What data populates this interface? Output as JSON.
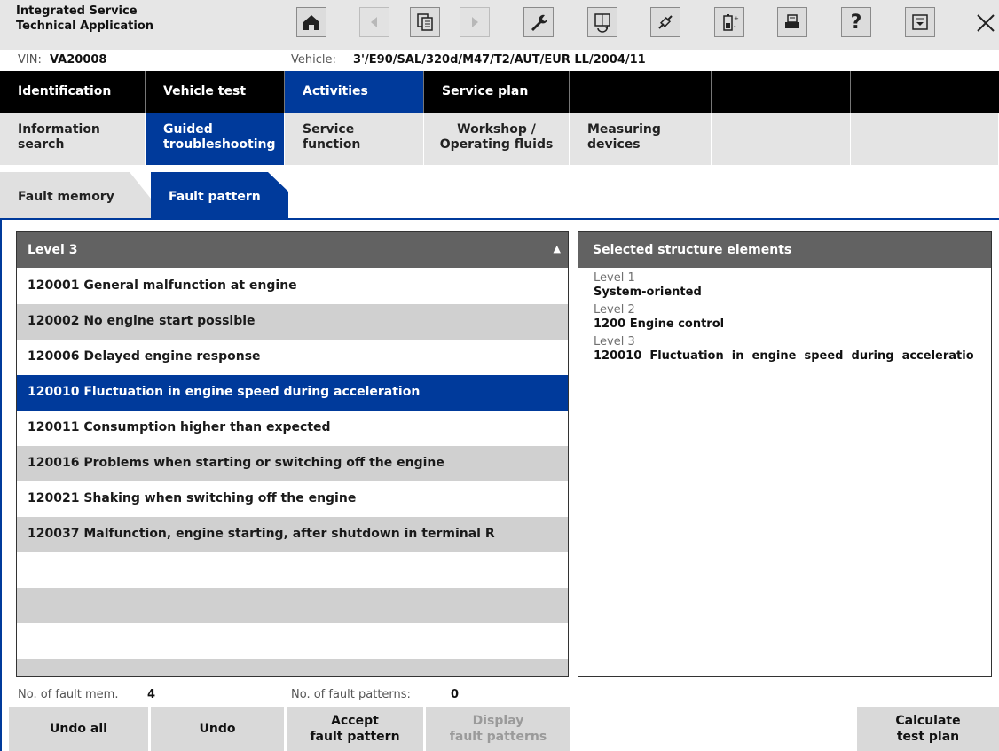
{
  "app": {
    "title_line1": "Integrated Service",
    "title_line2": "Technical Application"
  },
  "toolbar": {
    "icons": [
      "home-icon",
      "back-arrow-icon",
      "documents-icon",
      "forward-arrow-icon",
      "wrench-icon",
      "code-sheet-icon",
      "cable-icon",
      "battery-icon",
      "printer-icon",
      "help-icon",
      "dropdown-menu-icon",
      "close-icon"
    ],
    "help_label": "?"
  },
  "vehicle": {
    "vin_label": "VIN:",
    "vin": "VA20008",
    "vehicle_label": "Vehicle:",
    "vehicle": "3'/E90/SAL/320d/M47/T2/AUT/EUR LL/2004/11"
  },
  "main_tabs": [
    {
      "label": "Identification"
    },
    {
      "label": "Vehicle test"
    },
    {
      "label": "Activities"
    },
    {
      "label": "Service plan"
    }
  ],
  "sub_tabs": [
    {
      "line1": "Information",
      "line2": "search"
    },
    {
      "line1": "Guided",
      "line2": "troubleshooting"
    },
    {
      "line1": "Service",
      "line2": "function"
    },
    {
      "line1": "Workshop /",
      "line2": "Operating fluids"
    },
    {
      "line1": "Measuring",
      "line2": "devices"
    }
  ],
  "breadcrumbs": [
    {
      "label": "Fault memory"
    },
    {
      "label": "Fault pattern"
    }
  ],
  "level_list": {
    "header": "Level 3",
    "sort_indicator": "▲",
    "items": [
      "120001 General malfunction at engine",
      "120002 No engine start possible",
      "120006 Delayed engine response",
      "120010 Fluctuation in engine speed during acceleration",
      "120011 Consumption higher than expected",
      "120016 Problems when starting or switching off the engine",
      "120021 Shaking when switching off the engine",
      "120037 Malfunction, engine starting, after shutdown in terminal R"
    ],
    "selected_index": 3
  },
  "structure": {
    "header": "Selected structure elements",
    "entries": [
      {
        "level": "Level 1",
        "value": "System-oriented"
      },
      {
        "level": "Level 2",
        "value": "1200 Engine control"
      },
      {
        "level": "Level 3",
        "value": "120010  Fluctuation  in  engine  speed  during  acceleratio"
      }
    ]
  },
  "counts": {
    "fault_mem_label": "No. of fault mem.",
    "fault_mem_value": "4",
    "fault_patterns_label": "No. of fault patterns:",
    "fault_patterns_value": "0"
  },
  "buttons": {
    "undo_all": "Undo all",
    "undo": "Undo",
    "accept_line1": "Accept",
    "accept_line2": "fault pattern",
    "display_line1": "Display",
    "display_line2": "fault patterns",
    "calculate_line1": "Calculate",
    "calculate_line2": "test plan"
  },
  "colors": {
    "accent_blue": "#003a9b",
    "header_gray": "#626262",
    "row_alt_gray": "#d0d0d0"
  }
}
